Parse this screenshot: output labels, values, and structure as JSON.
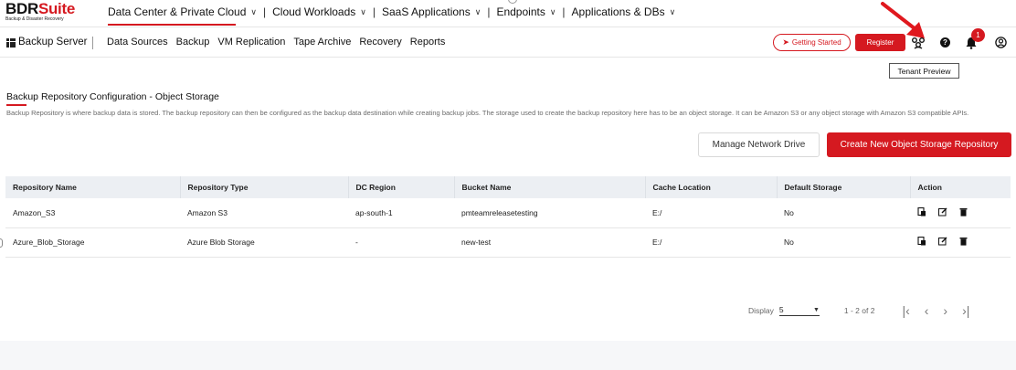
{
  "brand": {
    "logo_bdr": "BDR",
    "logo_suite": "Suite",
    "logo_sub": "Backup & Disaster Recovery"
  },
  "top_nav": [
    {
      "label": "Data Center & Private Cloud"
    },
    {
      "label": "Cloud Workloads"
    },
    {
      "label": "SaaS Applications"
    },
    {
      "label": "Endpoints"
    },
    {
      "label": "Applications & DBs"
    }
  ],
  "top_nav_separator": "|",
  "sub_nav": {
    "section": "Backup Server",
    "items": [
      "Data Sources",
      "Backup",
      "VM Replication",
      "Tape Archive",
      "Recovery",
      "Reports"
    ]
  },
  "header_actions": {
    "getting_started": "Getting Started",
    "register": "Register",
    "notification_count": "1",
    "tooltip": "Tenant Preview"
  },
  "icons": {
    "tenant": "tenant-preview-icon",
    "help": "help-icon",
    "bell": "bell-icon",
    "user": "user-icon"
  },
  "colors": {
    "brand_red": "#d51920",
    "header_bg": "#eceff3"
  },
  "page": {
    "title": "Backup Repository Configuration - Object Storage",
    "description": "Backup Repository is where backup data is stored. The backup repository can then be configured as the backup data destination while creating backup jobs. The storage used to create the backup repository here has to be an object storage. It can be Amazon S3 or any object storage with Amazon S3 compatible APIs.",
    "manage_button": "Manage Network Drive",
    "create_button": "Create New Object Storage Repository"
  },
  "table": {
    "columns": [
      "Repository Name",
      "Repository Type",
      "DC Region",
      "Bucket Name",
      "Cache Location",
      "Default Storage",
      "Action"
    ],
    "rows": [
      {
        "name": "Amazon_S3",
        "type": "Amazon S3",
        "region": "ap-south-1",
        "bucket": "pmteamreleasetesting",
        "cache": "E:/",
        "default": "No"
      },
      {
        "name": "Azure_Blob_Storage",
        "type": "Azure Blob Storage",
        "region": "-",
        "bucket": "new-test",
        "cache": "E:/",
        "default": "No"
      }
    ]
  },
  "pagination": {
    "display_label": "Display",
    "page_size": "5",
    "range": "1 - 2 of 2"
  }
}
